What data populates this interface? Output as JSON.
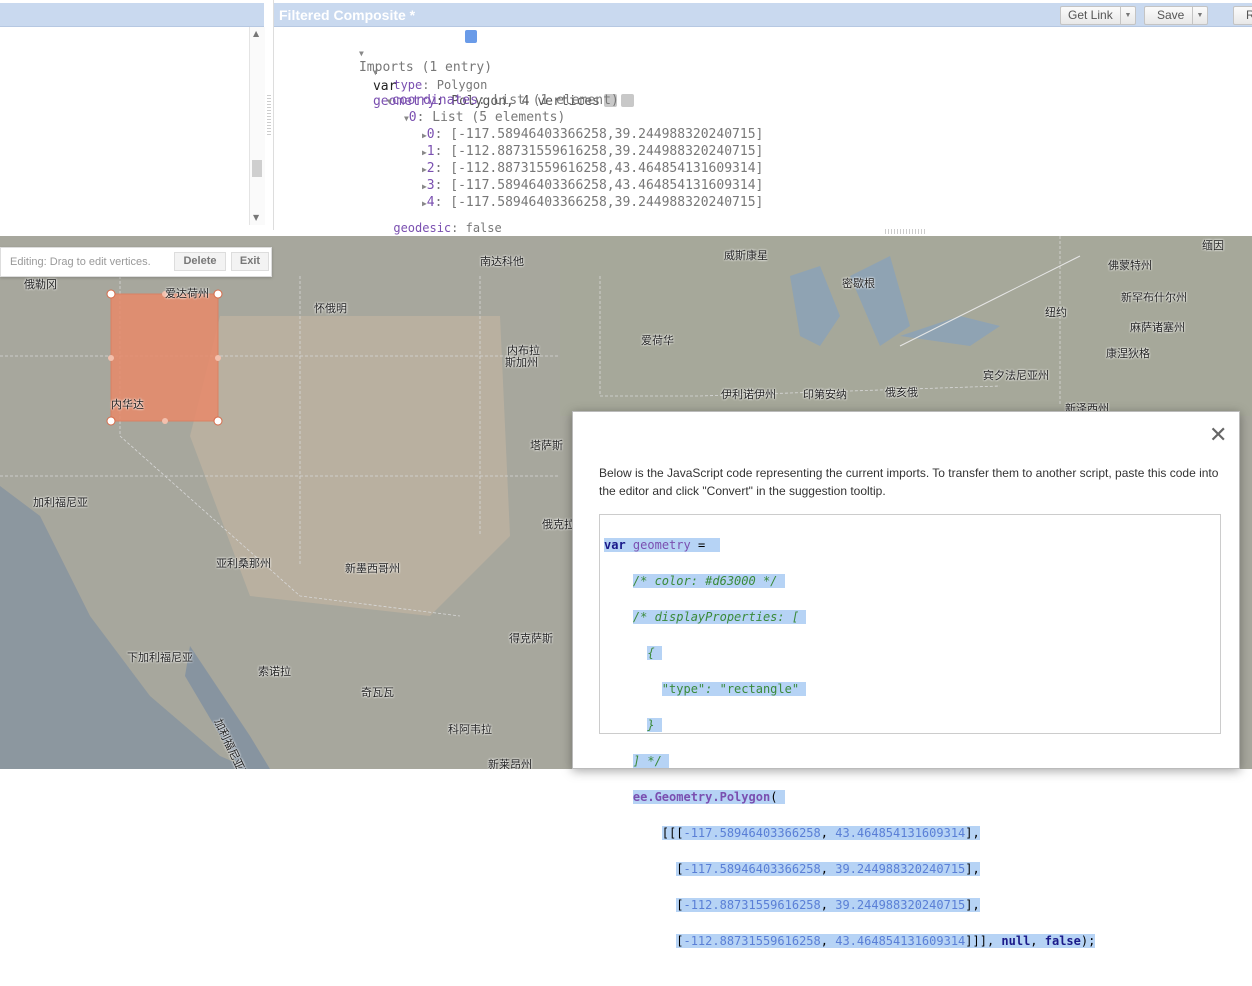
{
  "editor": {
    "title": "Filtered Composite *",
    "get_link": "Get Link",
    "save": "Save",
    "run_partial": "R"
  },
  "imports": {
    "header": "Imports (1 entry)",
    "var_kw": "var",
    "var_name": "geometry",
    "var_summary": ": Polygon, 4 vertices",
    "type_key": "type",
    "type_val": ": Polygon",
    "coords_key": "coordinates",
    "coords_val": ": List (1 element)",
    "list_key": "0",
    "list_val": ": List (5 elements)",
    "points": [
      {
        "idx": "0",
        "val": ": [-117.58946403366258,39.244988320240715]"
      },
      {
        "idx": "1",
        "val": ": [-112.88731559616258,39.244988320240715]"
      },
      {
        "idx": "2",
        "val": ": [-112.88731559616258,43.464854131609314]"
      },
      {
        "idx": "3",
        "val": ": [-117.58946403366258,43.464854131609314]"
      },
      {
        "idx": "4",
        "val": ": [-117.58946403366258,39.244988320240715]"
      }
    ],
    "geodesic_key": "geodesic",
    "geodesic_val": ": false"
  },
  "map": {
    "editing_text": "Editing: Drag to edit vertices.",
    "delete": "Delete",
    "exit": "Exit",
    "polygon_color": "#d63000",
    "labels": [
      "俄勒冈",
      "爱达荷州",
      "怀俄明",
      "南达科他",
      "威斯康星",
      "密歇根",
      "佛蒙特州",
      "缅因",
      "新罕布什尔州",
      "纽约",
      "麻萨诸塞州",
      "康涅狄格",
      "内布拉",
      "斯加州",
      "爱荷华",
      "伊利诺伊州",
      "印第安纳",
      "俄亥俄",
      "宾夕法尼亚州",
      "新泽西州",
      "内华达",
      "塔萨斯",
      "加利福尼亚",
      "俄克拉",
      "亚利桑那州",
      "新墨西哥州",
      "得克萨斯",
      "下加利福尼亚",
      "索诺拉",
      "奇瓦瓦",
      "科阿韦拉",
      "加利福尼亚湾",
      "新莱昂州"
    ]
  },
  "dialog": {
    "description": "Below is the JavaScript code representing the current imports. To transfer them to another script, paste this code into the editor and click \"Convert\" in the suggestion tooltip.",
    "code": {
      "l1_kw": "var",
      "l1_name": "geometry",
      "l1_eq": " =",
      "l2": "/* color: #d63000 */",
      "l3": "/* displayProperties: [",
      "l4": "{",
      "l5_key": "\"type\"",
      "l5_sep": ": ",
      "l5_val": "\"rectangle\"",
      "l6": "}",
      "l7": "] */",
      "l8_fn": "ee.Geometry.Polygon",
      "l8_paren": "(",
      "coords": [
        {
          "pre": "[[[",
          "a": "-117.58946403366258",
          "b": "43.464854131609314",
          "post": "],"
        },
        {
          "pre": "[",
          "a": "-117.58946403366258",
          "b": "39.244988320240715",
          "post": "],"
        },
        {
          "pre": "[",
          "a": "-112.88731559616258",
          "b": "39.244988320240715",
          "post": "],"
        },
        {
          "pre": "[",
          "a": "-112.88731559616258",
          "b": "43.464854131609314",
          "post": "]]], "
        }
      ],
      "tail_null": "null",
      "tail_sep": ", ",
      "tail_false": "false",
      "tail_end": ");"
    }
  }
}
